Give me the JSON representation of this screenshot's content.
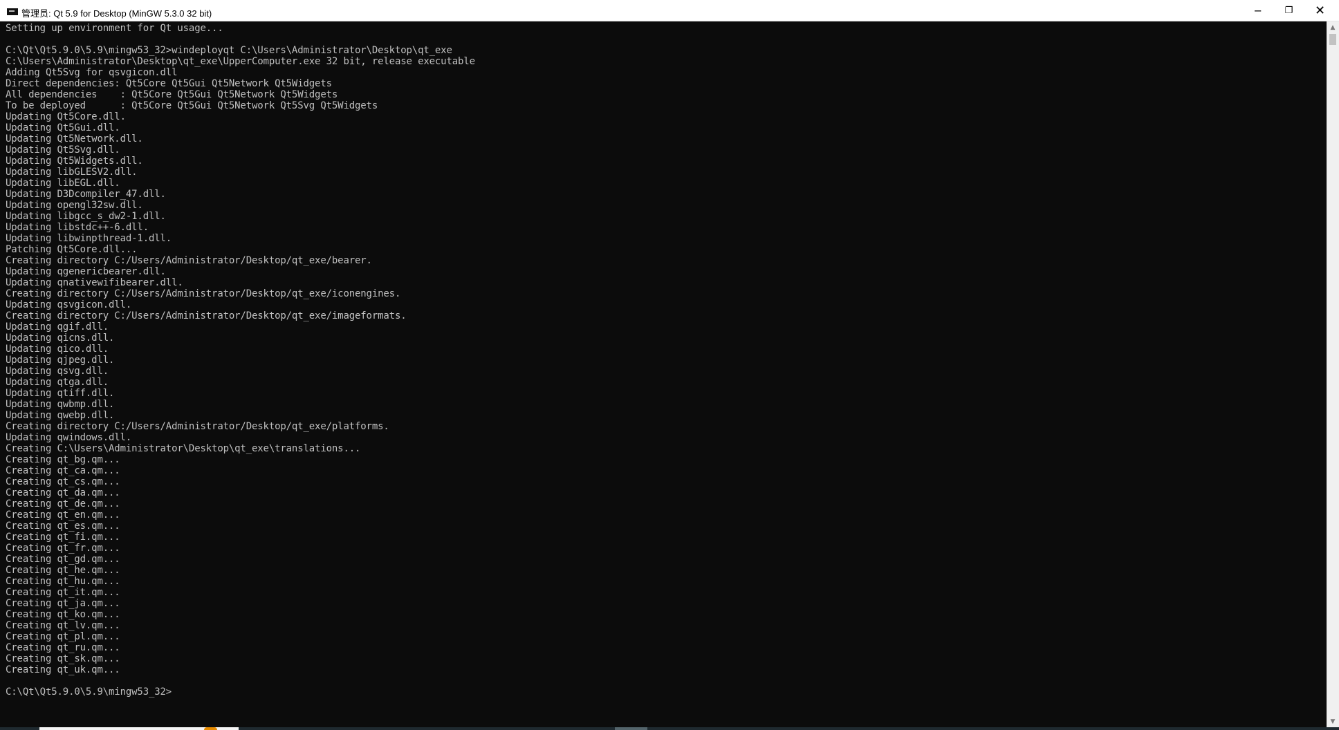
{
  "window": {
    "title": "管理员: Qt 5.9 for Desktop (MinGW 5.3.0 32 bit)",
    "controls": {
      "minimize": "─",
      "maximize": "❐",
      "close": "✕"
    }
  },
  "console": {
    "text": "Setting up environment for Qt usage...\n\nC:\\Qt\\Qt5.9.0\\5.9\\mingw53_32>windeployqt C:\\Users\\Administrator\\Desktop\\qt_exe\nC:\\Users\\Administrator\\Desktop\\qt_exe\\UpperComputer.exe 32 bit, release executable\nAdding Qt5Svg for qsvgicon.dll\nDirect dependencies: Qt5Core Qt5Gui Qt5Network Qt5Widgets\nAll dependencies    : Qt5Core Qt5Gui Qt5Network Qt5Widgets\nTo be deployed      : Qt5Core Qt5Gui Qt5Network Qt5Svg Qt5Widgets\nUpdating Qt5Core.dll.\nUpdating Qt5Gui.dll.\nUpdating Qt5Network.dll.\nUpdating Qt5Svg.dll.\nUpdating Qt5Widgets.dll.\nUpdating libGLESV2.dll.\nUpdating libEGL.dll.\nUpdating D3Dcompiler_47.dll.\nUpdating opengl32sw.dll.\nUpdating libgcc_s_dw2-1.dll.\nUpdating libstdc++-6.dll.\nUpdating libwinpthread-1.dll.\nPatching Qt5Core.dll...\nCreating directory C:/Users/Administrator/Desktop/qt_exe/bearer.\nUpdating qgenericbearer.dll.\nUpdating qnativewifibearer.dll.\nCreating directory C:/Users/Administrator/Desktop/qt_exe/iconengines.\nUpdating qsvgicon.dll.\nCreating directory C:/Users/Administrator/Desktop/qt_exe/imageformats.\nUpdating qgif.dll.\nUpdating qicns.dll.\nUpdating qico.dll.\nUpdating qjpeg.dll.\nUpdating qsvg.dll.\nUpdating qtga.dll.\nUpdating qtiff.dll.\nUpdating qwbmp.dll.\nUpdating qwebp.dll.\nCreating directory C:/Users/Administrator/Desktop/qt_exe/platforms.\nUpdating qwindows.dll.\nCreating C:\\Users\\Administrator\\Desktop\\qt_exe\\translations...\nCreating qt_bg.qm...\nCreating qt_ca.qm...\nCreating qt_cs.qm...\nCreating qt_da.qm...\nCreating qt_de.qm...\nCreating qt_en.qm...\nCreating qt_es.qm...\nCreating qt_fi.qm...\nCreating qt_fr.qm...\nCreating qt_gd.qm...\nCreating qt_he.qm...\nCreating qt_hu.qm...\nCreating qt_it.qm...\nCreating qt_ja.qm...\nCreating qt_ko.qm...\nCreating qt_lv.qm...\nCreating qt_pl.qm...\nCreating qt_ru.qm...\nCreating qt_sk.qm...\nCreating qt_uk.qm...\n\nC:\\Qt\\Qt5.9.0\\5.9\\mingw53_32>"
  },
  "scrollbar": {
    "up_arrow": "▲",
    "down_arrow": "▼"
  },
  "colors": {
    "console_background": "#0c0c0c",
    "console_text": "#c0c0c0",
    "titlebar_background": "#ffffff",
    "scrollbar_background": "#f0f0f0"
  },
  "icons": {
    "app": "console-app-icon",
    "minimize": "minimize-icon",
    "maximize": "maximize-icon",
    "close": "close-icon"
  }
}
